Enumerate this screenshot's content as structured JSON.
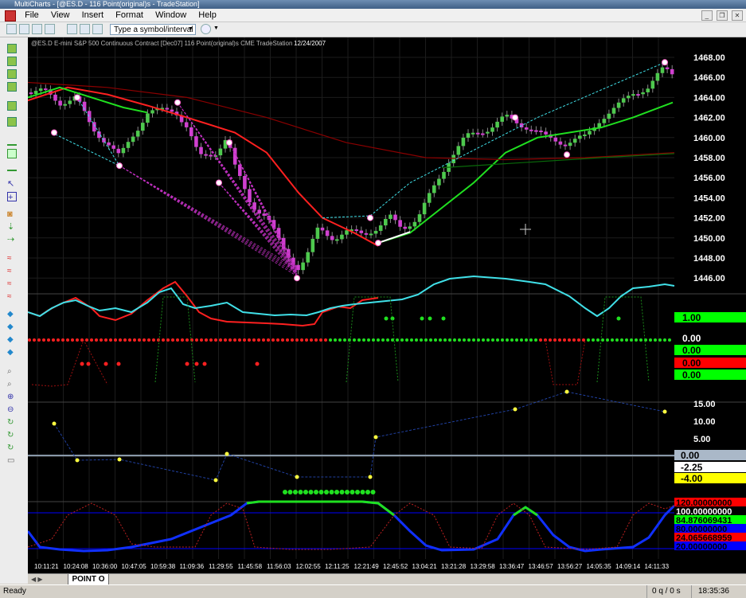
{
  "window": {
    "title": "MultiCharts - [@ES.D - 116 Point(original)s - TradeStation]"
  },
  "menu": {
    "items": [
      "File",
      "View",
      "Insert",
      "Format",
      "Window",
      "Help"
    ]
  },
  "toolbar": {
    "symbol_placeholder": "Type a symbol/interval"
  },
  "chart": {
    "header": "@ES.D  E-mini S&P 500 Continuous Contract [Dec07]  116 Point(original)s  CME  TradeStation",
    "date": "12/24/2007",
    "price_ticks": [
      "1468.00",
      "1466.00",
      "1464.00",
      "1462.00",
      "1460.00",
      "1458.00",
      "1456.00",
      "1454.00",
      "1452.00",
      "1450.00",
      "1448.00",
      "1446.00"
    ],
    "time_ticks": [
      "10:11:21",
      "10:24:08",
      "10:36:00",
      "10:47:05",
      "10:59:38",
      "11:09:36",
      "11:29:55",
      "11:45:58",
      "11:56:03",
      "12:02:55",
      "12:11:25",
      "12:21:49",
      "12:45:52",
      "13:04:21",
      "13:21:28",
      "13:29:58",
      "13:36:47",
      "13:46:57",
      "13:56:27",
      "14:05:35",
      "14:09:14",
      "14:11:33"
    ],
    "osc_labels": [
      {
        "text": "1.00",
        "bg": "#00ff00",
        "fg": "#000"
      },
      {
        "text": "0.00",
        "bg": "#000000",
        "fg": "#fff"
      },
      {
        "text": "0.00",
        "bg": "#00ff00",
        "fg": "#000"
      },
      {
        "text": "0.00",
        "bg": "#ff0000",
        "fg": "#000"
      },
      {
        "text": "0.00",
        "bg": "#00ff00",
        "fg": "#000"
      }
    ],
    "p3_ticks": [
      "15.00",
      "10.00",
      "5.00"
    ],
    "p3_labels": [
      {
        "text": "0.00",
        "bg": "#aab8c8",
        "fg": "#000"
      },
      {
        "text": "-2.25",
        "bg": "#ffffff",
        "fg": "#000"
      },
      {
        "text": "-4.00",
        "bg": "#ffff00",
        "fg": "#000"
      }
    ],
    "p4_labels": [
      {
        "text": "120.00000000",
        "bg": "#ff0000",
        "fg": "#000"
      },
      {
        "text": "100.00000000",
        "bg": "#000000",
        "fg": "#fff"
      },
      {
        "text": "84.876069431",
        "bg": "#00ff00",
        "fg": "#000"
      },
      {
        "text": "80.00000000",
        "bg": "#0000ff",
        "fg": "#000"
      },
      {
        "text": "24.065668959",
        "bg": "#ff0000",
        "fg": "#000"
      },
      {
        "text": "20.00000000",
        "bg": "#0000ff",
        "fg": "#000"
      }
    ]
  },
  "tabs": {
    "active": "POINT O"
  },
  "status": {
    "ready": "Ready",
    "queue": "0 q / 0 s",
    "clock": "18:35:36"
  },
  "colors": {
    "bull": "#4ec94e",
    "bear": "#d040d0",
    "cyan": "#40e0e8",
    "red": "#ff2020",
    "green": "#20e020",
    "blue": "#1030ff"
  }
}
